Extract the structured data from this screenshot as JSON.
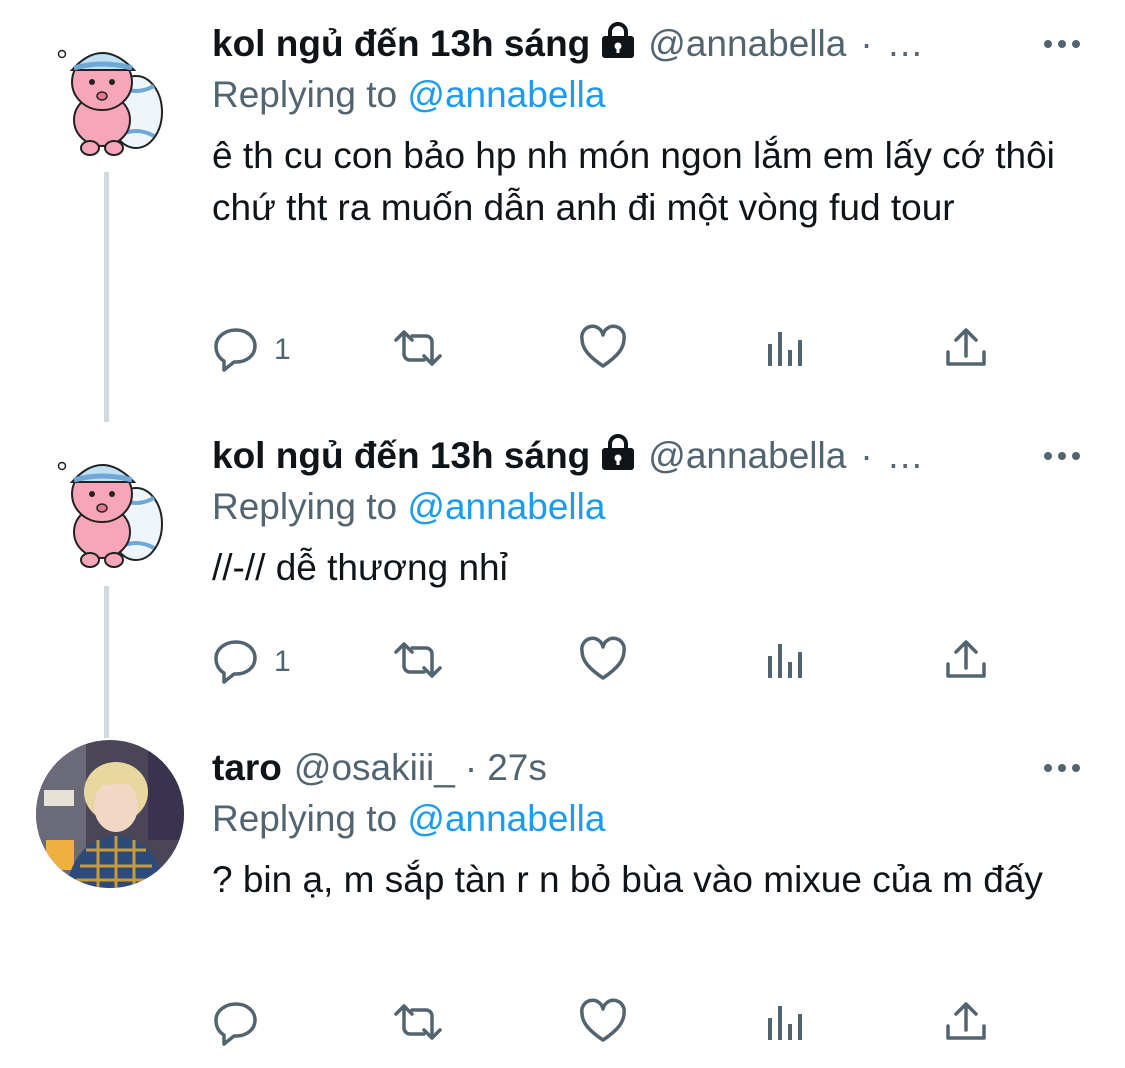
{
  "tweets": [
    {
      "name": "kol ngủ đến 13h sáng",
      "handle": "@annabella",
      "time_sep": "·",
      "time": "…",
      "replying_prefix": "Replying to",
      "replying_to": "@annabella",
      "text": "ê th cu con bảo hp nh món ngon lắm em lấy cớ thôi chứ tht ra muốn dẫn anh đi một vòng fud tour",
      "reply_count": "1",
      "avatar": "sleepy-pink-character-icon"
    },
    {
      "name": "kol ngủ đến 13h sáng",
      "handle": "@annabella",
      "time_sep": "·",
      "time": "…",
      "replying_prefix": "Replying to",
      "replying_to": "@annabella",
      "text": "//-// dễ thương nhỉ",
      "reply_count": "1",
      "avatar": "sleepy-pink-character-icon"
    },
    {
      "name": "taro",
      "handle": "@osakiii_",
      "time_sep": "·",
      "time": "27s",
      "replying_prefix": "Replying to",
      "replying_to": "@annabella",
      "text": "? bin ạ, m sắp tàn r n bỏ bùa vào mixue của m đấy",
      "reply_count": "",
      "avatar": "profile-photo"
    }
  ],
  "colors": {
    "link": "#1d9bf0",
    "muted": "#536471",
    "text": "#0f1419",
    "thread_line": "#d4d9dd"
  }
}
